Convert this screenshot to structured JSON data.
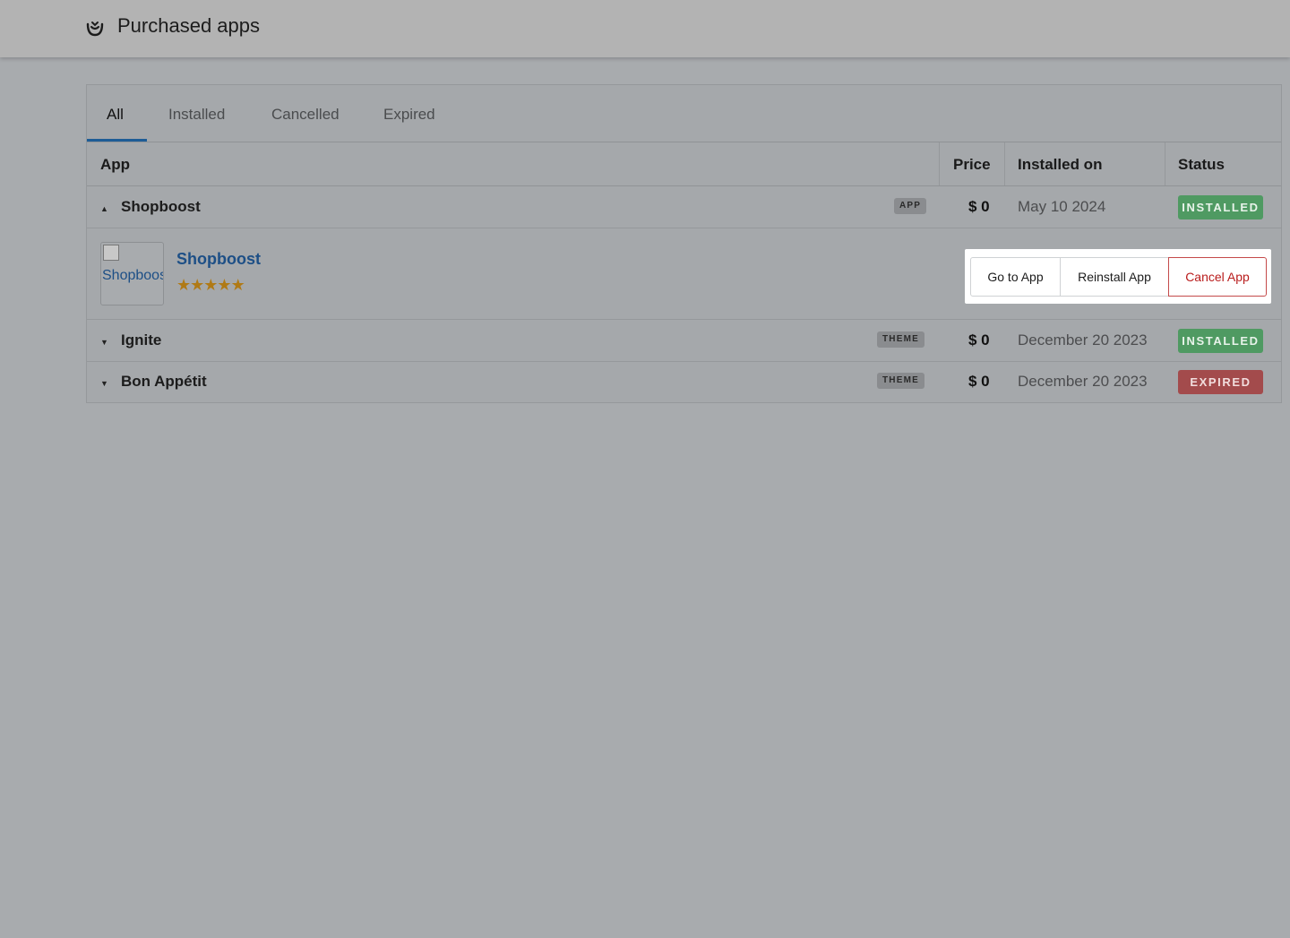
{
  "header": {
    "title": "Purchased apps",
    "logo_icon": "smile-logo-icon"
  },
  "tabs": [
    {
      "label": "All",
      "active": true
    },
    {
      "label": "Installed",
      "active": false
    },
    {
      "label": "Cancelled",
      "active": false
    },
    {
      "label": "Expired",
      "active": false
    }
  ],
  "table": {
    "columns": [
      "App",
      "Price",
      "Installed on",
      "Status"
    ],
    "rows": [
      {
        "name": "Shopboost",
        "type": "APP",
        "price": "$ 0",
        "installed_on": "May 10 2024",
        "status": "INSTALLED",
        "expanded": true
      },
      {
        "name": "Ignite",
        "type": "THEME",
        "price": "$ 0",
        "installed_on": "December 20 2023",
        "status": "INSTALLED",
        "expanded": false
      },
      {
        "name": "Bon Appétit",
        "type": "THEME",
        "price": "$ 0",
        "installed_on": "December 20 2023",
        "status": "EXPIRED",
        "expanded": false
      }
    ]
  },
  "detail": {
    "thumbnail_alt": "Shopboost",
    "app_name": "Shopboost",
    "rating": 5,
    "rating_max": 5,
    "actions": {
      "go_to_app": "Go to App",
      "reinstall_app": "Reinstall App",
      "cancel_app": "Cancel App"
    }
  },
  "colors": {
    "installed": "#4f9a62",
    "expired": "#a34b4c",
    "link": "#1d4f86",
    "active_tab": "#1d5c96",
    "cancel": "#b91c1c"
  }
}
